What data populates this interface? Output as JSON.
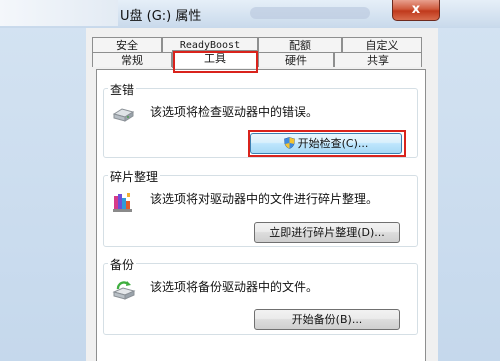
{
  "window": {
    "title": "U盘 (G:) 属性",
    "close_glyph": "x"
  },
  "tabs": {
    "row1": [
      "安全",
      "ReadyBoost",
      "配额",
      "自定义"
    ],
    "row2": [
      "常规",
      "工具",
      "硬件",
      "共享"
    ],
    "active": "工具"
  },
  "groups": {
    "check": {
      "title": "查错",
      "description": "该选项将检查驱动器中的错误。",
      "button": "开始检查(C)..."
    },
    "defrag": {
      "title": "碎片整理",
      "description": "该选项将对驱动器中的文件进行碎片整理。",
      "button": "立即进行碎片整理(D)..."
    },
    "backup": {
      "title": "备份",
      "description": "该选项将备份驱动器中的文件。",
      "button": "开始备份(B)..."
    }
  },
  "colors": {
    "highlight": "#d9231c",
    "frame": "#c5d8ec",
    "close_button": "#c0391c"
  },
  "icons": [
    "drive-icon",
    "defrag-icon",
    "backup-icon",
    "uac-shield-icon",
    "close-icon"
  ]
}
